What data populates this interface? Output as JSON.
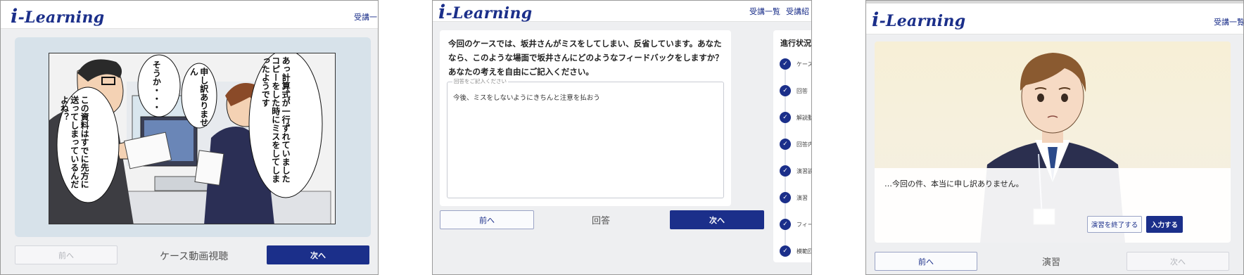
{
  "brand": {
    "logo_i": "i",
    "logo_rest": "-Learning",
    "color": "#1b2f8a"
  },
  "panel1": {
    "nav_link": "受講一",
    "manga": {
      "bubble_a": "あっ計算式が一行ずれていましたコピーをした時にミスをしてしまったようです",
      "bubble_b": "申し訳ありません",
      "bubble_c": "そうか・・・",
      "bubble_d": "この資料はすでに先方に送ってしまっているんだよね？"
    },
    "prev_label": "前へ",
    "step_label": "ケース動画視聴",
    "next_label": "次へ"
  },
  "panel2": {
    "nav_links": [
      "受講一覧",
      "受講紹"
    ],
    "question": "今回のケースでは、坂井さんがミスをしてしまい、反省しています。あなたなら、このような場面で坂井さんにどのようなフィードバックをしますか？あなたの考えを自由にご記入ください。",
    "answer_label": "回答をご記入ください",
    "answer_text": "今後、ミスをしないようにきちんと注意を払おう",
    "prev_label": "前へ",
    "step_label": "回答",
    "next_label": "次へ",
    "progress": {
      "title": "進行状況",
      "items": [
        "ケース",
        "回答",
        "解説動",
        "回答内",
        "演習説",
        "演習",
        "フィー",
        "模範回"
      ]
    }
  },
  "panel3": {
    "nav_link": "受講一覧",
    "dialog_text": "…今回の件、本当に申し訳ありません。",
    "end_label": "演習を終了する",
    "input_label": "入力する",
    "prev_label": "前へ",
    "step_label": "演習",
    "next_label": "次へ"
  }
}
